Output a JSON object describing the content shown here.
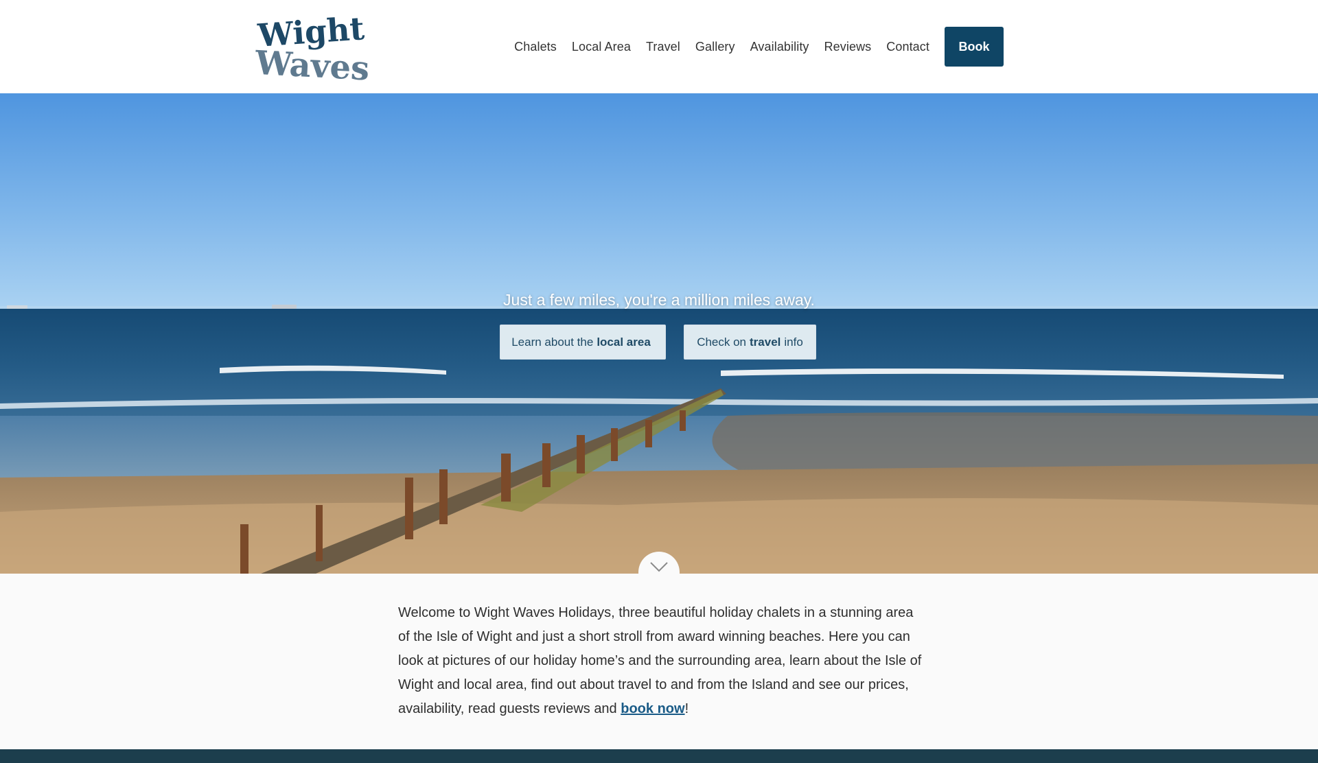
{
  "header": {
    "logo_text": [
      "Wight",
      "Waves"
    ],
    "nav": [
      "Chalets",
      "Local Area",
      "Travel",
      "Gallery",
      "Availability",
      "Reviews",
      "Contact"
    ],
    "book_label": "Book"
  },
  "hero": {
    "tagline": "Just a few miles, you're a million miles away.",
    "btn_local": {
      "pre": "Learn about the",
      "bold": "local area",
      "post": ""
    },
    "btn_travel": {
      "pre": "Check on",
      "bold": "travel",
      "post": "info"
    },
    "scroll_icon": "chevron-down-icon"
  },
  "intro": {
    "text": "Welcome to Wight Waves Holidays, three beautiful holiday chalets in a stunning area of the Isle of Wight and just a short stroll from award winning beaches.  Here you can look at pictures of our holiday home’s and the surrounding area, learn about the Isle of Wight and  local area, find out about travel to and from the Island and see our prices, availability, read guests reviews and",
    "link": "book now",
    "end": "!"
  },
  "colors": {
    "brand": "#0f4565",
    "link": "#1a5b87",
    "footer": "#1c3e4d"
  }
}
